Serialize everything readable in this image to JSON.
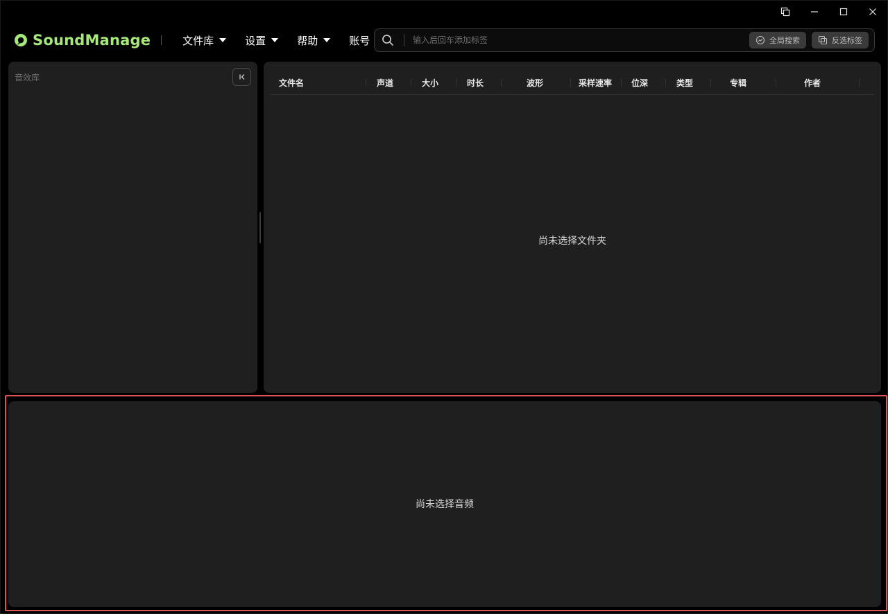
{
  "window_controls": {
    "items": [
      {
        "name": "restore-window-icon"
      },
      {
        "name": "minimize-icon"
      },
      {
        "name": "maximize-icon"
      },
      {
        "name": "close-icon"
      }
    ]
  },
  "header": {
    "app_name": "SoundManage",
    "brand_color": "#a6e879",
    "menu": [
      {
        "label": "文件库",
        "has_dropdown": true
      },
      {
        "label": "设置",
        "has_dropdown": true
      },
      {
        "label": "帮助",
        "has_dropdown": true
      },
      {
        "label": "账号",
        "has_dropdown": false
      }
    ],
    "search": {
      "placeholder": "输入后回车添加标签",
      "value": "",
      "global_search_label": "全局搜索",
      "invert_tags_label": "反选标签"
    }
  },
  "library_panel": {
    "title": "音效库"
  },
  "file_table": {
    "columns": [
      "文件名",
      "声道",
      "大小",
      "时长",
      "波形",
      "采样速率",
      "位深",
      "类型",
      "专辑",
      "作者"
    ],
    "empty_message": "尚未选择文件夹"
  },
  "player_panel": {
    "empty_message": "尚未选择音频",
    "highlight_color": "#e05454"
  }
}
